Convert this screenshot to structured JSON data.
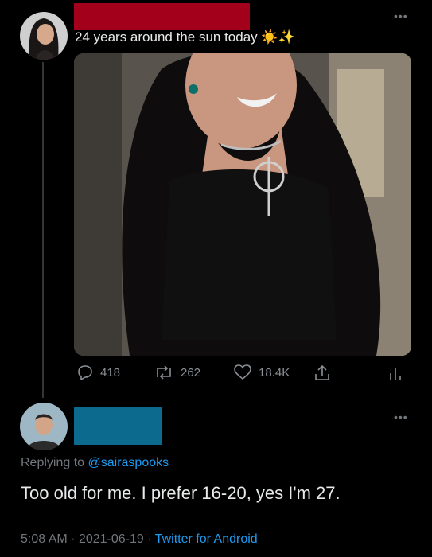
{
  "tweet": {
    "text": "24 years around the sun today",
    "emojis": "☀️✨",
    "more_label": "•••",
    "actions": {
      "replies": "418",
      "retweets": "262",
      "likes": "18.4K"
    }
  },
  "reply": {
    "more_label": "•••",
    "replying_prefix": "Replying to ",
    "replying_handle": "@sairaspooks",
    "text": "Too old for me. I prefer 16-20, yes I'm 27.",
    "time": "5:08 AM",
    "date": "2021-06-19",
    "separator": "·",
    "source": "Twitter for Android"
  },
  "colors": {
    "background": "#000000",
    "redaction_top": "#a3001b",
    "redaction_bottom": "#0b6a8e",
    "link": "#1d9bf0",
    "muted": "#71767b"
  }
}
